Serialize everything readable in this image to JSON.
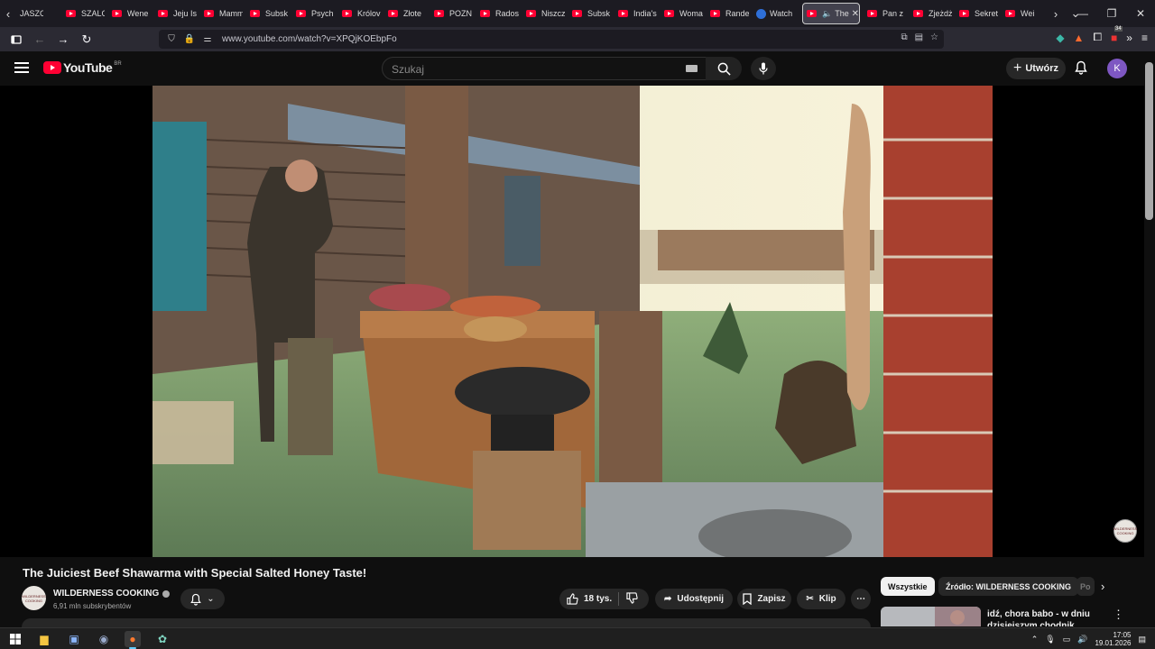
{
  "browser": {
    "tabs": [
      {
        "title": "JASZC",
        "icon": "none"
      },
      {
        "title": "SZALC",
        "icon": "youtube"
      },
      {
        "title": "Wene",
        "icon": "youtube"
      },
      {
        "title": "Jeju Is",
        "icon": "youtube"
      },
      {
        "title": "Mamm",
        "icon": "youtube"
      },
      {
        "title": "Subsk",
        "icon": "youtube"
      },
      {
        "title": "Psych",
        "icon": "youtube"
      },
      {
        "title": "Królov",
        "icon": "youtube"
      },
      {
        "title": "Złote",
        "icon": "youtube"
      },
      {
        "title": "POZN",
        "icon": "youtube"
      },
      {
        "title": "Rados",
        "icon": "youtube"
      },
      {
        "title": "Niszcz",
        "icon": "youtube"
      },
      {
        "title": "Subsk",
        "icon": "youtube"
      },
      {
        "title": "India's",
        "icon": "youtube"
      },
      {
        "title": "Woma",
        "icon": "youtube"
      },
      {
        "title": "Rande",
        "icon": "youtube"
      },
      {
        "title": "Watch",
        "icon": "generic"
      }
    ],
    "active_tab": {
      "title": "The",
      "close": "✕"
    },
    "tabs_after": [
      {
        "title": "Pan z",
        "icon": "youtube"
      },
      {
        "title": "Zjeżdż",
        "icon": "youtube"
      },
      {
        "title": "Sekret",
        "icon": "youtube"
      },
      {
        "title": "Wei",
        "icon": "youtube"
      }
    ],
    "url": "www.youtube.com/watch?v=XPQjKOEbpFo",
    "extension_badge": "34"
  },
  "youtube": {
    "logo_text": "YouTube",
    "country_code": "BR",
    "search_placeholder": "Szukaj",
    "create_label": "Utwórz",
    "avatar_letter": "K",
    "watermark_text": "WILDERNESS COOKING"
  },
  "video": {
    "title": "The Juiciest Beef Shawarma with Special Salted Honey Taste!",
    "channel": "WILDERNESS COOKING",
    "subscribers": "6,91 mln subskrybentów",
    "likes": "18 tys.",
    "share_label": "Udostępnij",
    "save_label": "Zapisz",
    "clip_label": "Klip"
  },
  "sidebar": {
    "chips": [
      "Wszystkie",
      "Źródło: WILDERNESS COOKING",
      "Po"
    ],
    "rec_title": "idź, chora babo - w dniu dzisiejszym chodnik pieszym"
  },
  "taskbar": {
    "time": "17:05",
    "date": "19.01.2026"
  },
  "colors": {
    "yt_red": "#ff0033",
    "background": "#0f0f0f",
    "avatar": "#7e57c2"
  }
}
